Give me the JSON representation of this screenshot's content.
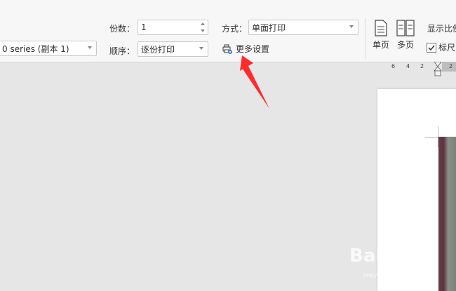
{
  "printer": {
    "value": "0 series (副本 1)"
  },
  "copies": {
    "label": "份数：",
    "value": "1"
  },
  "order": {
    "label": "顺序：",
    "value": "逐份打印"
  },
  "mode": {
    "label": "方式：",
    "value": "单面打印"
  },
  "more_settings": {
    "label": "更多设置"
  },
  "view": {
    "single_page": "单页",
    "multi_page": "多页",
    "zoom_label": "显示比例",
    "ruler": "标尺",
    "ruler_checked": true
  },
  "ruler_ticks": [
    "6",
    "4",
    "2",
    "2"
  ],
  "watermark": {
    "text": "Bai经验",
    "sub": "jingyan.baidu.com"
  },
  "colors": {
    "accent": "#2b579a",
    "annotation_arrow": "#ff2a2a"
  }
}
